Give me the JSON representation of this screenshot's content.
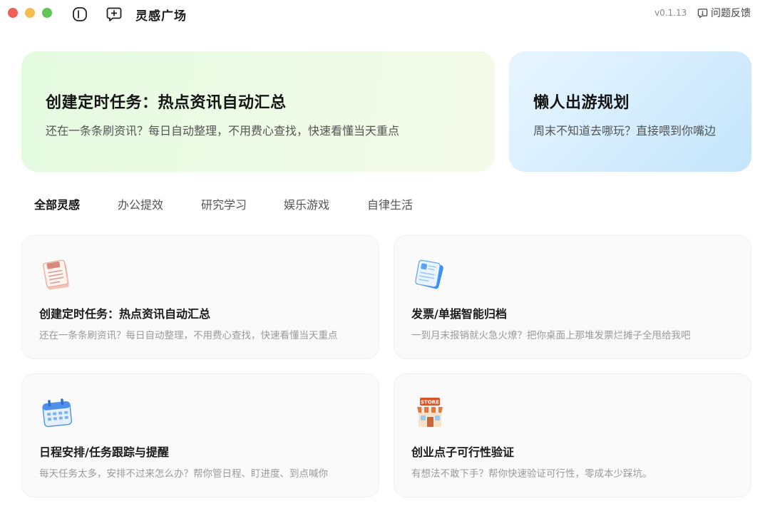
{
  "app": {
    "title": "灵感广场",
    "version": "v0.1.13",
    "feedback_label": "问题反馈",
    "icons": {
      "sidebar": "sidebar-toggle-icon",
      "new_chat": "new-chat-icon",
      "feedback": "feedback-icon"
    }
  },
  "window_controls": {
    "close": "#ee5f57",
    "minimize": "#f4bd4f",
    "zoom": "#61c454"
  },
  "banners": [
    {
      "title": "创建定时任务：热点资讯自动汇总",
      "description": "还在一条条刷资讯？每日自动整理，不用费心查找，快速看懂当天重点"
    },
    {
      "title": "懒人出游规划",
      "description": "周末不知道去哪玩？直接喂到你嘴边"
    }
  ],
  "tabs": [
    {
      "label": "全部灵感",
      "active": true
    },
    {
      "label": "办公提效",
      "active": false
    },
    {
      "label": "研究学习",
      "active": false
    },
    {
      "label": "娱乐游戏",
      "active": false
    },
    {
      "label": "自律生活",
      "active": false
    }
  ],
  "cards": [
    {
      "icon": "newspaper-icon",
      "title": "创建定时任务：热点资讯自动汇总",
      "description": "还在一条条刷资讯？每日自动整理，不用费心查找，快速看懂当天重点"
    },
    {
      "icon": "invoice-icon",
      "title": "发票/单据智能归档",
      "description": "一到月末报销就火急火燎？把你桌面上那堆发票烂摊子全甩给我吧"
    },
    {
      "icon": "calendar-icon",
      "title": "日程安排/任务跟踪与提醒",
      "description": "每天任务太多，安排不过来怎么办？帮你管日程、盯进度、到点喊你"
    },
    {
      "icon": "store-icon",
      "icon_text": "STORE",
      "title": "创业点子可行性验证",
      "description": "有想法不敢下手？帮你快速验证可行性，零成本少踩坑。"
    }
  ]
}
